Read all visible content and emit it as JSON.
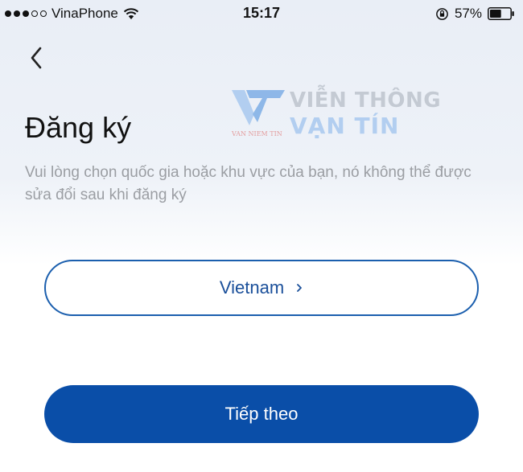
{
  "status_bar": {
    "carrier": "VinaPhone",
    "time": "15:17",
    "battery_percent": "57%",
    "battery_level": 0.57,
    "signal_bars_filled": 3,
    "signal_bars_total": 5,
    "icons": [
      "signal-dots-icon",
      "wifi-icon",
      "rotation-lock-icon",
      "battery-icon"
    ]
  },
  "nav": {
    "back_icon": "chevron-left-icon"
  },
  "watermark": {
    "line1": "VIỄN THÔNG",
    "line2": "VẠN TÍN",
    "small_text": "VAN NIEM TIN"
  },
  "page": {
    "title": "Đăng ký",
    "subtitle": "Vui lòng chọn quốc gia hoặc khu vực của bạn, nó không thể được sửa đổi sau khi đăng ký"
  },
  "country_selector": {
    "value": "Vietnam",
    "icon": "chevron-right-icon"
  },
  "next_button": {
    "label": "Tiếp theo"
  },
  "colors": {
    "primary": "#0a4ea8",
    "selector_border": "#1b5fae",
    "selector_text": "#1a4f9a",
    "subtitle_text": "#9b9ea3",
    "header_bg": "#e9eef6"
  }
}
